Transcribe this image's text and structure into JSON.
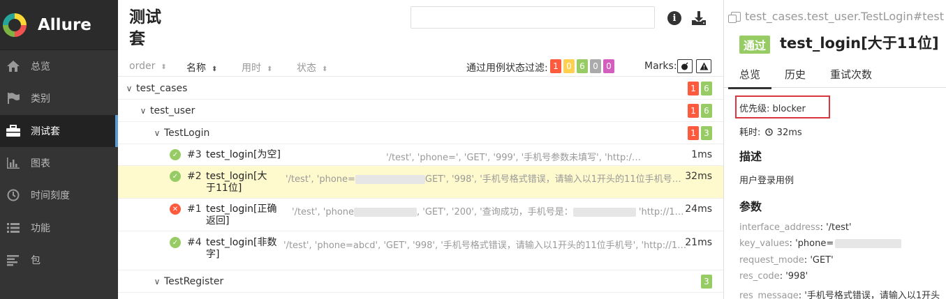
{
  "app": {
    "name": "Allure"
  },
  "sidebar": {
    "items": [
      {
        "label": "总览",
        "icon": "home-icon"
      },
      {
        "label": "类别",
        "icon": "flag-icon"
      },
      {
        "label": "测试套",
        "icon": "briefcase-icon",
        "active": true
      },
      {
        "label": "图表",
        "icon": "bar-chart-icon"
      },
      {
        "label": "时间刻度",
        "icon": "clock-icon"
      },
      {
        "label": "功能",
        "icon": "list-icon"
      },
      {
        "label": "包",
        "icon": "align-left-icon"
      }
    ]
  },
  "middle": {
    "title_line1": "测试",
    "title_line2": "套",
    "search": {
      "value": "",
      "placeholder": ""
    },
    "columns": {
      "order": "order",
      "name": "名称",
      "duration": "用时",
      "status": "状态"
    },
    "filter_label": "通过用例状态过滤:",
    "filter_counts": [
      "1",
      "0",
      "6",
      "0",
      "0"
    ],
    "marks_label": "Marks:",
    "tree": {
      "root": {
        "name": "test_cases",
        "failed": "1",
        "passed": "6"
      },
      "module": {
        "name": "test_user",
        "failed": "1",
        "passed": "6"
      },
      "class1": {
        "name": "TestLogin",
        "failed": "1",
        "passed": "3"
      },
      "class2": {
        "name": "TestRegister",
        "passed": "3"
      }
    },
    "tests": [
      {
        "num": "#3",
        "name": "test_login[为空]",
        "params_a": "'/test', 'phone=', 'GET', '999', '手机号参数未填写', 'http:/",
        "params_b": "",
        "duration": "1ms",
        "status": "passed"
      },
      {
        "num": "#2",
        "name": "test_login[大于11位]",
        "params_a": "'/test', 'phone=",
        "params_b": "GET', '998', '手机号格式错误，请输入以1开头的11位手机号'…",
        "duration": "32ms",
        "status": "passed"
      },
      {
        "num": "#1",
        "name": "test_login[正确返回]",
        "params_a": "'/test', 'phone",
        "params_b": ", 'GET', '200', '查询成功，手机号是：",
        "params_c": "'http://1…",
        "duration": "24ms",
        "status": "failed"
      },
      {
        "num": "#4",
        "name": "test_login[非数字]",
        "params_a": "'/test', 'phone=abcd', 'GET', '998', '手机号格式错误，请输入以1开头的11位手机号', 'http://10…",
        "params_b": "",
        "duration": "21ms",
        "status": "passed"
      }
    ]
  },
  "detail": {
    "breadcrumb": "test_cases.test_user.TestLogin#test",
    "status": "通过",
    "title": "test_login[大于11位]",
    "tabs": [
      "总览",
      "历史",
      "重试次数"
    ],
    "priority": "优先级: blocker",
    "duration_label": "耗时:",
    "duration": "32ms",
    "desc_heading": "描述",
    "description": "用户登录用例",
    "params_heading": "参数",
    "params": [
      {
        "key": "interface_address",
        "value": "'/test'"
      },
      {
        "key": "key_values",
        "value": "'phone="
      },
      {
        "key": "request_mode",
        "value": "'GET'"
      },
      {
        "key": "res_code",
        "value": "'998'"
      },
      {
        "key": "res_message",
        "value": "'手机号格式错误，请输入以1开头"
      }
    ]
  }
}
